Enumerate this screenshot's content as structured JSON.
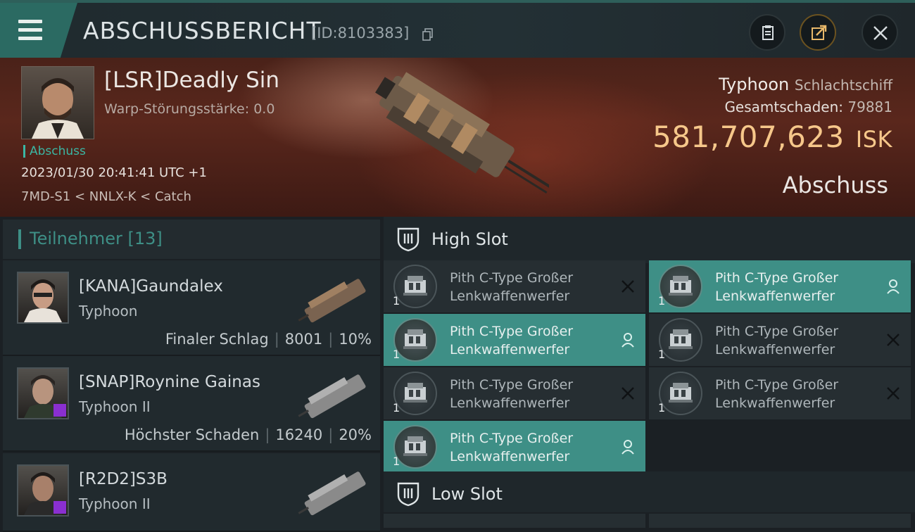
{
  "header": {
    "title": "ABSCHUSSBERICHT",
    "id": "[ID:8103383]",
    "buttons": [
      "clipboard-icon",
      "share-icon",
      "close-icon"
    ]
  },
  "victim": {
    "name": "[LSR]Deadly Sin",
    "warp": "Warp-Störungsstärke: 0.0",
    "tag": "Abschuss",
    "time": "2023/01/30 20:41:41 UTC +1",
    "location": "7MD-S1 < NNLX-K < Catch",
    "ship_name": "Typhoon",
    "ship_class": "Schlachtschiff",
    "damage_label": "Gesamtschaden:",
    "damage_value": "79881",
    "isk_value": "581,707,623",
    "isk_unit": "ISK",
    "state": "Abschuss"
  },
  "participants": {
    "title": "Teilnehmer",
    "count": "[13]",
    "list": [
      {
        "name": "[KANA]Gaundalex",
        "ship": "Typhoon",
        "role": "Finaler Schlag",
        "damage": "8001",
        "percent": "10%"
      },
      {
        "name": "[SNAP]Roynine Gainas",
        "ship": "Typhoon II",
        "role": "Höchster Schaden",
        "damage": "16240",
        "percent": "20%"
      },
      {
        "name": "[R2D2]S3B",
        "ship": "Typhoon II",
        "role": "",
        "damage": "",
        "percent": ""
      }
    ]
  },
  "slots": {
    "high_label": "High Slot",
    "low_label": "Low Slot",
    "high_items": [
      {
        "line1": "Pith C-Type Großer",
        "line2": "Lenkwaffenwerfer",
        "qty": "1",
        "state": "destroyed"
      },
      {
        "line1": "Pith C-Type Großer",
        "line2": "Lenkwaffenwerfer",
        "qty": "1",
        "state": "dropped"
      },
      {
        "line1": "Pith C-Type Großer",
        "line2": "Lenkwaffenwerfer",
        "qty": "1",
        "state": "dropped"
      },
      {
        "line1": "Pith C-Type Großer",
        "line2": "Lenkwaffenwerfer",
        "qty": "1",
        "state": "destroyed"
      },
      {
        "line1": "Pith C-Type Großer",
        "line2": "Lenkwaffenwerfer",
        "qty": "1",
        "state": "destroyed"
      },
      {
        "line1": "Pith C-Type Großer",
        "line2": "Lenkwaffenwerfer",
        "qty": "1",
        "state": "destroyed"
      },
      {
        "line1": "Pith C-Type Großer",
        "line2": "Lenkwaffenwerfer",
        "qty": "1",
        "state": "dropped"
      }
    ]
  },
  "colors": {
    "accent": "#3e8f86",
    "isk": "#f6c78a",
    "banner": "#4a2219",
    "badge": "#8a2fd0"
  }
}
